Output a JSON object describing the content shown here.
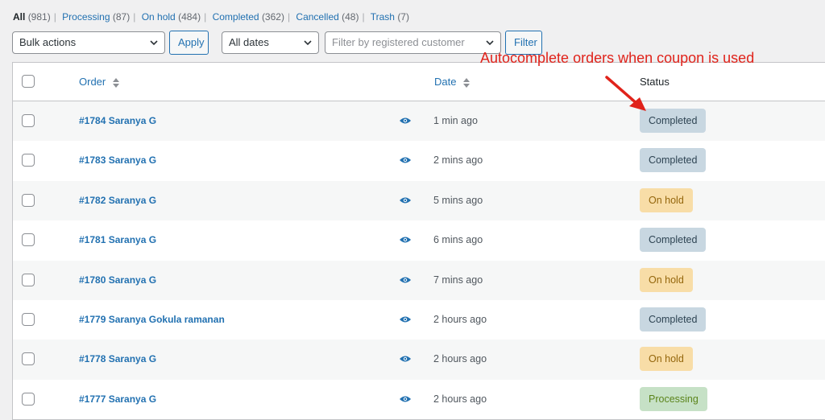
{
  "filters": {
    "all_label": "All",
    "all_count": "(981)",
    "processing_label": "Processing",
    "processing_count": "(87)",
    "onhold_label": "On hold",
    "onhold_count": "(484)",
    "completed_label": "Completed",
    "completed_count": "(362)",
    "cancelled_label": "Cancelled",
    "cancelled_count": "(48)",
    "trash_label": "Trash",
    "trash_count": "(7)",
    "separator": "|"
  },
  "toolbar": {
    "bulk_actions": "Bulk actions",
    "apply": "Apply",
    "dates": "All dates",
    "customer_placeholder": "Filter by registered customer",
    "filter": "Filter"
  },
  "annotation": "Autocomplete orders when coupon is used",
  "table": {
    "headers": {
      "order": "Order",
      "date": "Date",
      "status": "Status"
    },
    "rows": [
      {
        "order": "#1784 Saranya G",
        "date": "1 min ago",
        "status": "Completed"
      },
      {
        "order": "#1783 Saranya G",
        "date": "2 mins ago",
        "status": "Completed"
      },
      {
        "order": "#1782 Saranya G",
        "date": "5 mins ago",
        "status": "On hold"
      },
      {
        "order": "#1781 Saranya G",
        "date": "6 mins ago",
        "status": "Completed"
      },
      {
        "order": "#1780 Saranya G",
        "date": "7 mins ago",
        "status": "On hold"
      },
      {
        "order": "#1779 Saranya Gokula ramanan",
        "date": "2 hours ago",
        "status": "Completed"
      },
      {
        "order": "#1778 Saranya G",
        "date": "2 hours ago",
        "status": "On hold"
      },
      {
        "order": "#1777 Saranya G",
        "date": "2 hours ago",
        "status": "Processing"
      }
    ]
  },
  "status_colors": {
    "Completed": {
      "bg": "#c8d7e1",
      "fg": "#2e4453"
    },
    "On hold": {
      "bg": "#f8dda7",
      "fg": "#94660c"
    },
    "Processing": {
      "bg": "#c6e1c6",
      "fg": "#5b841b"
    }
  },
  "colors": {
    "accent": "#2271b1",
    "annotation": "#e0231b"
  }
}
